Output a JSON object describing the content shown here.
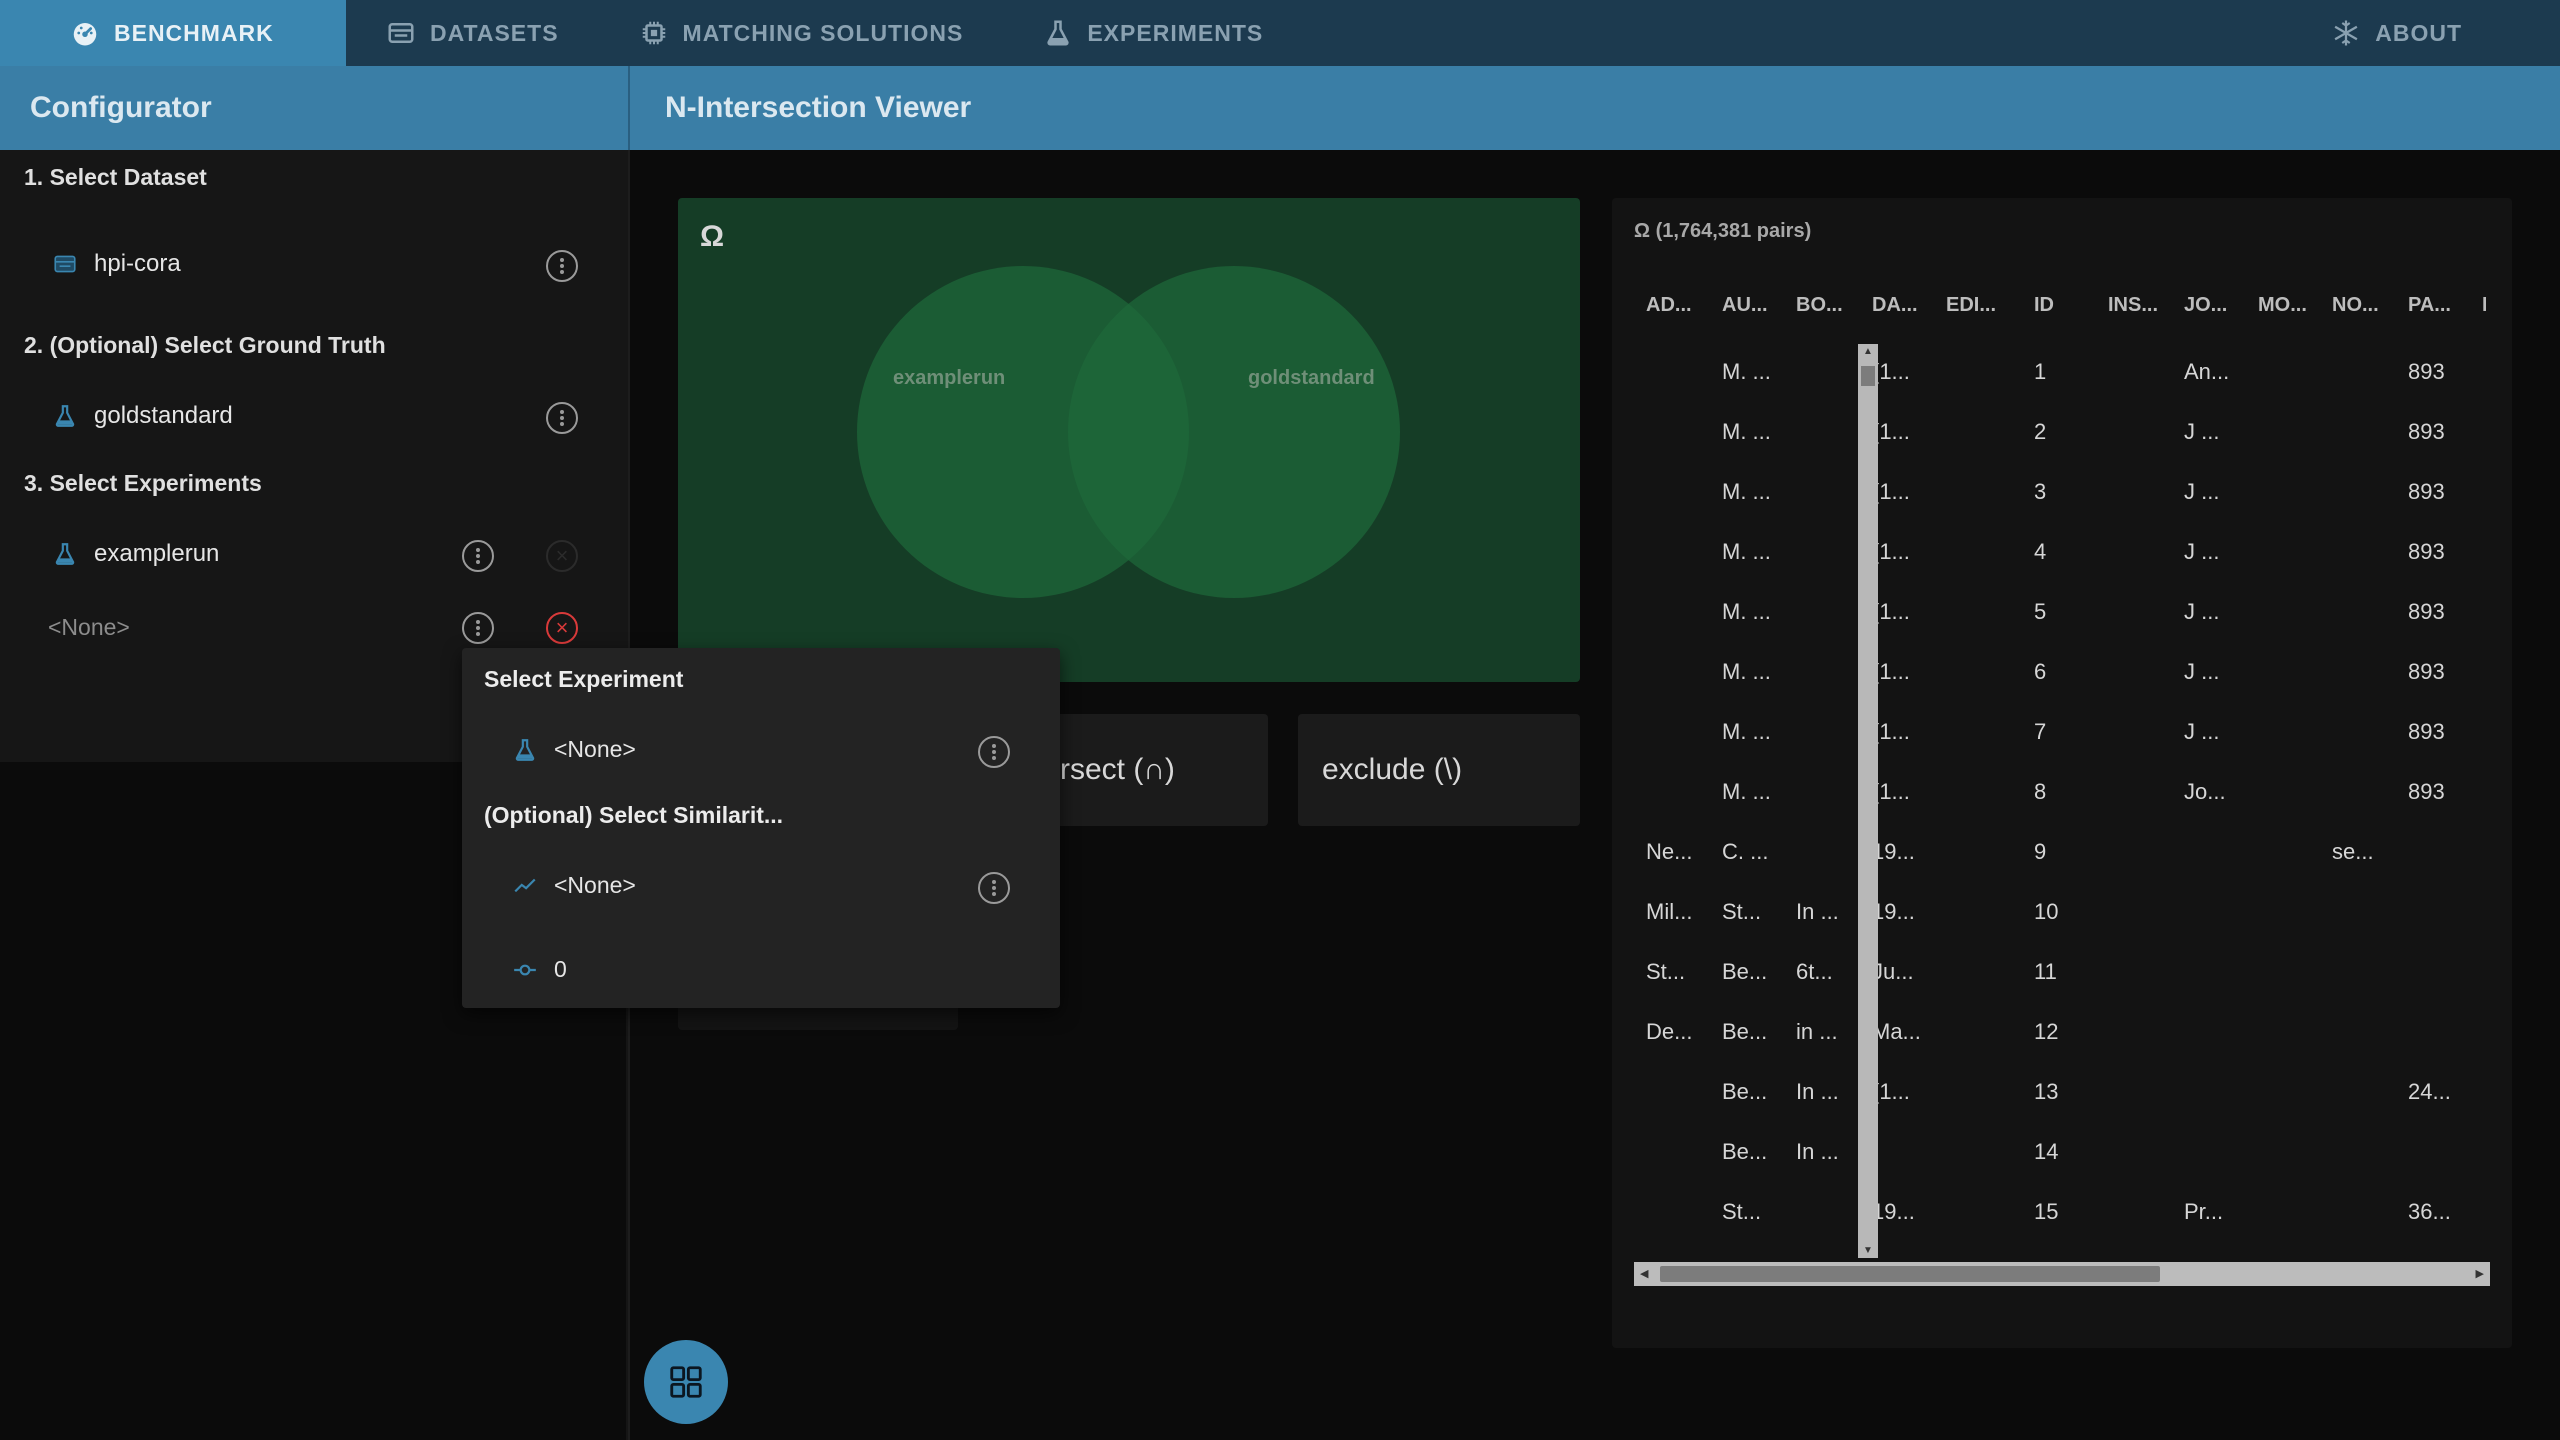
{
  "nav": {
    "tabs": [
      {
        "label": "BENCHMARK",
        "icon": "speedometer-icon",
        "active": true
      },
      {
        "label": "DATASETS",
        "icon": "dataset-icon"
      },
      {
        "label": "MATCHING SOLUTIONS",
        "icon": "chip-icon"
      },
      {
        "label": "EXPERIMENTS",
        "icon": "flask-icon"
      }
    ],
    "about": {
      "label": "ABOUT",
      "icon": "snowflake-icon"
    }
  },
  "header": {
    "left_title": "Configurator",
    "right_title": "N-Intersection Viewer"
  },
  "configurator": {
    "dataset_label": "1. Select Dataset",
    "dataset_value": "hpi-cora",
    "groundtruth_label": "2. (Optional) Select Ground Truth",
    "groundtruth_value": "goldstandard",
    "experiments_label": "3. Select Experiments",
    "experiment_1": "examplerun",
    "experiment_2": "<None>"
  },
  "popup": {
    "experiment_label": "Select Experiment",
    "experiment_value": "<None>",
    "similarity_label": "(Optional) Select Similarit...",
    "similarity_value": "<None>",
    "threshold_value": "0"
  },
  "venn": {
    "omega": "Ω",
    "set_a": "examplerun",
    "set_b": "goldstandard"
  },
  "operations": {
    "intersect": "rsect (∩)",
    "exclude": "exclude (\\)"
  },
  "table": {
    "title": "Ω (1,764,381 pairs)",
    "columns": [
      "AD...",
      "AU...",
      "BO...",
      "DA...",
      "EDI...",
      "ID",
      "INS...",
      "JO...",
      "MO...",
      "NO...",
      "PA...",
      "PU"
    ],
    "rows": [
      [
        "",
        "M. ...",
        "",
        "(1...",
        "",
        "1",
        "",
        "An...",
        "",
        "",
        "893",
        ""
      ],
      [
        "",
        "M. ...",
        "",
        "(1...",
        "",
        "2",
        "",
        "J ...",
        "",
        "",
        "893",
        ""
      ],
      [
        "",
        "M. ...",
        "",
        "(1...",
        "",
        "3",
        "",
        "J ...",
        "",
        "",
        "893",
        ""
      ],
      [
        "",
        "M. ...",
        "",
        "(1...",
        "",
        "4",
        "",
        "J ...",
        "",
        "",
        "893",
        ""
      ],
      [
        "",
        "M. ...",
        "",
        "(1...",
        "",
        "5",
        "",
        "J ...",
        "",
        "",
        "893",
        ""
      ],
      [
        "",
        "M. ...",
        "",
        "(1...",
        "",
        "6",
        "",
        "J ...",
        "",
        "",
        "893",
        ""
      ],
      [
        "",
        "M. ...",
        "",
        "(1...",
        "",
        "7",
        "",
        "J ...",
        "",
        "",
        "893",
        ""
      ],
      [
        "",
        "M. ...",
        "",
        "(1...",
        "",
        "8",
        "",
        "Jo...",
        "",
        "",
        "893",
        ""
      ],
      [
        "Ne...",
        "C. ...",
        "",
        "19...",
        "",
        "9",
        "",
        "",
        "",
        "se...",
        "",
        ""
      ],
      [
        "Mil...",
        "St...",
        "In ...",
        "19...",
        "",
        "10",
        "",
        "",
        "",
        "",
        "",
        ""
      ],
      [
        "St...",
        "Be...",
        "6t...",
        "Ju...",
        "",
        "11",
        "",
        "",
        "",
        "",
        "",
        ""
      ],
      [
        "De...",
        "Be...",
        "in ...",
        "Ma...",
        "",
        "12",
        "",
        "",
        "",
        "",
        "",
        ""
      ],
      [
        "",
        "Be...",
        "In ...",
        "(1...",
        "",
        "13",
        "",
        "",
        "",
        "",
        "24...",
        ""
      ],
      [
        "",
        "Be...",
        "In ...",
        "",
        "",
        "14",
        "",
        "",
        "",
        "",
        "",
        ""
      ],
      [
        "",
        "St...",
        "",
        "19...",
        "",
        "15",
        "",
        "Pr...",
        "",
        "",
        "36...",
        ""
      ]
    ]
  },
  "fab": {
    "icon": "grid-icon"
  },
  "colors": {
    "nav_bg": "#1c3a4f",
    "accent": "#3a86b0",
    "venn_bg": "#153d26",
    "venn_circle": "#1e6a3a",
    "danger": "#d93a3a"
  }
}
